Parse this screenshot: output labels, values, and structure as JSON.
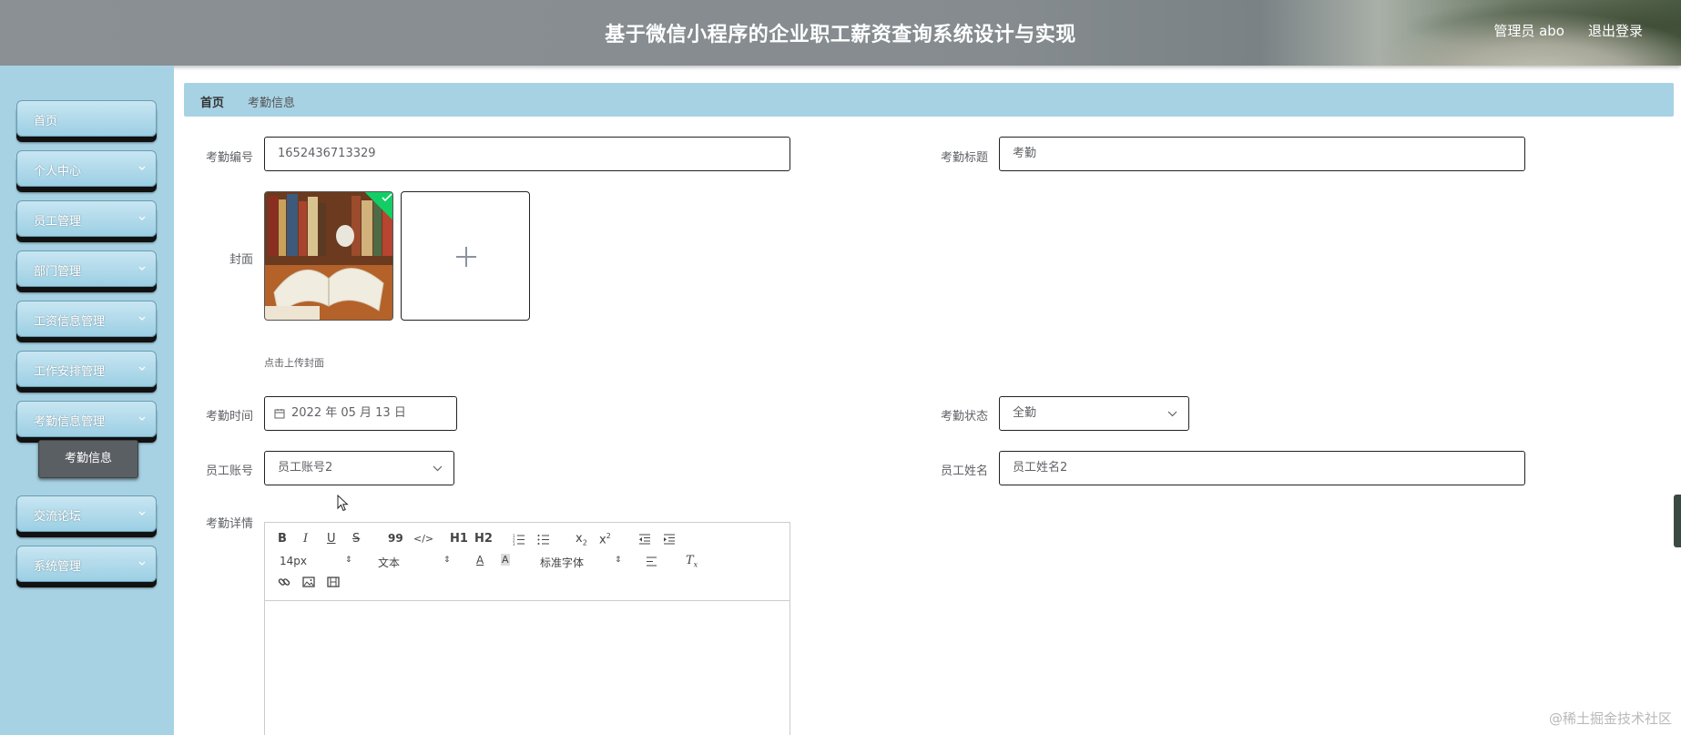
{
  "header": {
    "title": "基于微信小程序的企业职工薪资查询系统设计与实现",
    "user": "管理员 abo",
    "logout": "退出登录"
  },
  "sidebar": {
    "items": [
      {
        "label": "首页",
        "has_chevron": false
      },
      {
        "label": "个人中心",
        "has_chevron": true
      },
      {
        "label": "员工管理",
        "has_chevron": true
      },
      {
        "label": "部门管理",
        "has_chevron": true
      },
      {
        "label": "工资信息管理",
        "has_chevron": true
      },
      {
        "label": "工作安排管理",
        "has_chevron": true
      },
      {
        "label": "考勤信息管理",
        "has_chevron": true
      },
      {
        "label": "交流论坛",
        "has_chevron": true
      },
      {
        "label": "系统管理",
        "has_chevron": true
      }
    ],
    "active_sub_item": "考勤信息"
  },
  "breadcrumb": {
    "home": "首页",
    "current": "考勤信息"
  },
  "form": {
    "id": {
      "label": "考勤编号",
      "value": "1652436713329"
    },
    "title": {
      "label": "考勤标题",
      "value": "考勤"
    },
    "cover": {
      "label": "封面",
      "hint": "点击上传封面"
    },
    "time": {
      "label": "考勤时间",
      "value": "2022 年 05 月 13 日"
    },
    "status": {
      "label": "考勤状态",
      "value": "全勤"
    },
    "account": {
      "label": "员工账号",
      "value": "员工账号2"
    },
    "name": {
      "label": "员工姓名",
      "value": "员工姓名2"
    },
    "details": {
      "label": "考勤详情"
    }
  },
  "editor": {
    "font_size": "14px",
    "block_format": "文本",
    "font_family": "标准字体",
    "buttons": {
      "bold": "B",
      "italic": "I",
      "underline": "U",
      "strike": "S",
      "quote": "99",
      "code": "</>",
      "h1": "H1",
      "h2": "H2",
      "subscript": "x2",
      "superscript": "x2"
    }
  },
  "colors": {
    "sidebar_bg": "#a7d2e4",
    "breadcrumb_bg": "#a7d2e4",
    "active_sub_bg": "#5a5f63",
    "upload_success": "#13ce66"
  },
  "watermark": "@稀土掘金技术社区"
}
